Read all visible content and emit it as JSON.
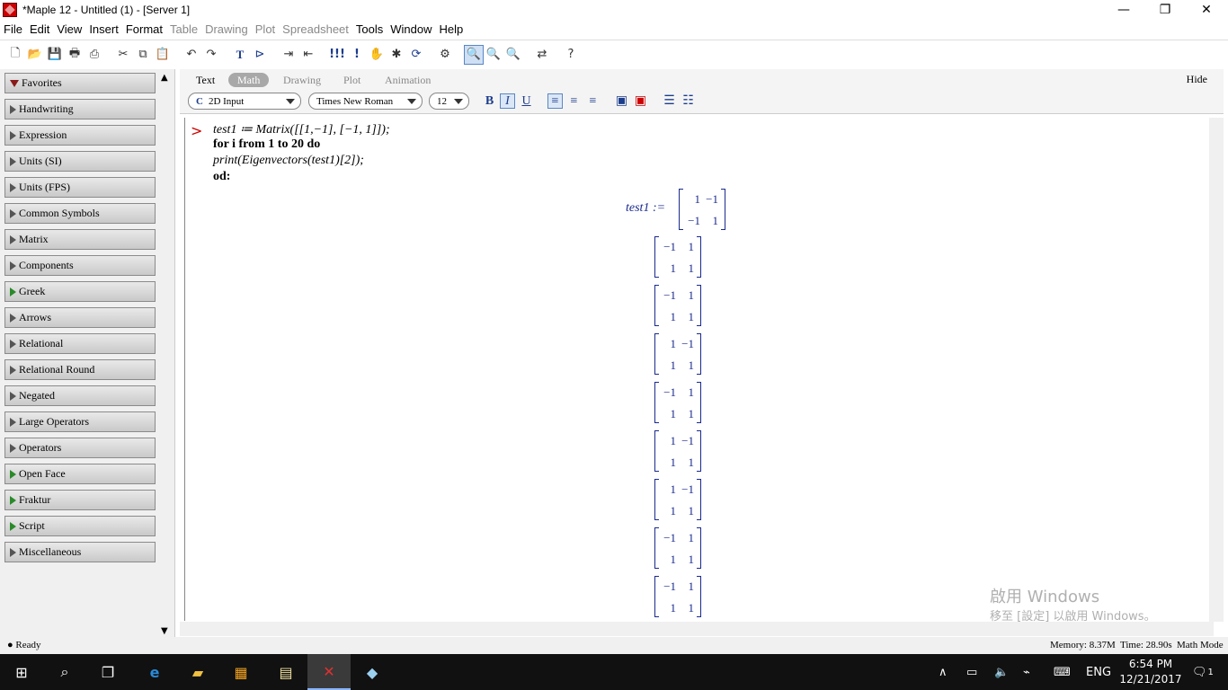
{
  "window": {
    "title": "*Maple 12 - Untitled (1) - [Server 1]",
    "min_glyph": "—",
    "max_glyph": "❐",
    "close_glyph": "✕"
  },
  "menu": [
    {
      "label": "File",
      "enabled": true
    },
    {
      "label": "Edit",
      "enabled": true
    },
    {
      "label": "View",
      "enabled": true
    },
    {
      "label": "Insert",
      "enabled": true
    },
    {
      "label": "Format",
      "enabled": true
    },
    {
      "label": "Table",
      "enabled": false
    },
    {
      "label": "Drawing",
      "enabled": false
    },
    {
      "label": "Plot",
      "enabled": false
    },
    {
      "label": "Spreadsheet",
      "enabled": false
    },
    {
      "label": "Tools",
      "enabled": true
    },
    {
      "label": "Window",
      "enabled": true
    },
    {
      "label": "Help",
      "enabled": true
    }
  ],
  "palette": {
    "items": [
      {
        "label": "Favorites",
        "expanded": true
      },
      {
        "label": "Handwriting"
      },
      {
        "label": "Expression"
      },
      {
        "label": "Units (SI)"
      },
      {
        "label": "Units (FPS)"
      },
      {
        "label": "Common Symbols"
      },
      {
        "label": "Matrix"
      },
      {
        "label": "Components"
      },
      {
        "label": "Greek",
        "green": true
      },
      {
        "label": "Arrows"
      },
      {
        "label": "Relational"
      },
      {
        "label": "Relational Round"
      },
      {
        "label": "Negated"
      },
      {
        "label": "Large Operators"
      },
      {
        "label": "Operators"
      },
      {
        "label": "Open Face",
        "green": true
      },
      {
        "label": "Fraktur",
        "green": true
      },
      {
        "label": "Script",
        "green": true
      },
      {
        "label": "Miscellaneous"
      }
    ]
  },
  "context": {
    "tabs": [
      "Text",
      "Math",
      "Drawing",
      "Plot",
      "Animation"
    ],
    "active_tab": "Math",
    "hide_label": "Hide",
    "input_mode": "2D Input",
    "input_mode_icon": "C",
    "font": "Times New Roman",
    "size": "12",
    "bold": "B",
    "italic": "I",
    "underline": "U"
  },
  "worksheet": {
    "prompt": ">",
    "lines": [
      "test1 ≔ Matrix([[1,−1], [−1, 1]]);",
      "for i from 1 to 20 do",
      "print(Eigenvectors(test1)[2]);",
      "od:"
    ],
    "assignment_label": "test1 :=",
    "test1_matrix": [
      [
        "1",
        "−1"
      ],
      [
        "−1",
        "1"
      ]
    ],
    "outputs": [
      [
        [
          "−1",
          "1"
        ],
        [
          "1",
          "1"
        ]
      ],
      [
        [
          "−1",
          "1"
        ],
        [
          "1",
          "1"
        ]
      ],
      [
        [
          "1",
          "−1"
        ],
        [
          "1",
          "1"
        ]
      ],
      [
        [
          "−1",
          "1"
        ],
        [
          "1",
          "1"
        ]
      ],
      [
        [
          "1",
          "−1"
        ],
        [
          "1",
          "1"
        ]
      ],
      [
        [
          "1",
          "−1"
        ],
        [
          "1",
          "1"
        ]
      ],
      [
        [
          "−1",
          "1"
        ],
        [
          "1",
          "1"
        ]
      ],
      [
        [
          "−1",
          "1"
        ],
        [
          "1",
          "1"
        ]
      ]
    ]
  },
  "watermark": {
    "line1": "啟用 Windows",
    "line2": "移至 [設定] 以啟用 Windows。"
  },
  "status": {
    "ready": "● Ready",
    "memory": "Memory: 8.37M",
    "time": "Time: 28.90s",
    "mode": "Math Mode"
  },
  "taskbar": {
    "language": "ENG",
    "time": "6:54 PM",
    "date": "12/21/2017",
    "notification_count": "1"
  }
}
